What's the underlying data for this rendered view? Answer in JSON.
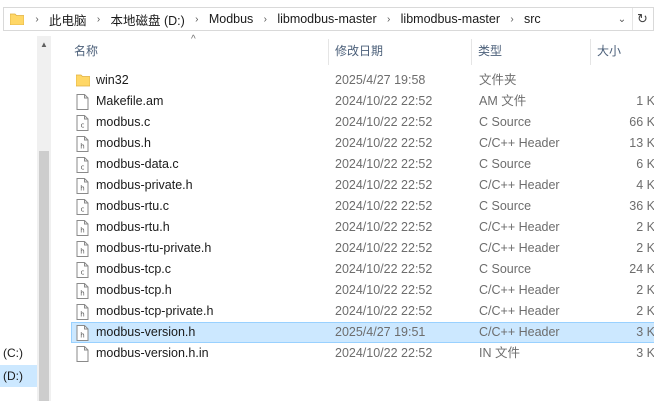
{
  "address": {
    "crumbs": [
      "此电脑",
      "本地磁盘 (D:)",
      "Modbus",
      "libmodbus-master",
      "libmodbus-master",
      "src"
    ],
    "separator": "›",
    "dropdown": "⌄",
    "refresh": "↻"
  },
  "nav": {
    "items": [
      {
        "label": "(C:)",
        "selected": false
      },
      {
        "label": "(D:)",
        "selected": true
      }
    ]
  },
  "columns": {
    "name": "名称",
    "date": "修改日期",
    "type": "类型",
    "size": "大小"
  },
  "files": [
    {
      "name": "win32",
      "date": "2025/4/27 19:58",
      "type": "文件夹",
      "size": "",
      "icon": "folder-icon",
      "selected": false
    },
    {
      "name": "Makefile.am",
      "date": "2024/10/22 22:52",
      "type": "AM 文件",
      "size": "1 K",
      "icon": "file-icon",
      "selected": false
    },
    {
      "name": "modbus.c",
      "date": "2024/10/22 22:52",
      "type": "C Source",
      "size": "66 K",
      "icon": "c-source-icon",
      "selected": false
    },
    {
      "name": "modbus.h",
      "date": "2024/10/22 22:52",
      "type": "C/C++ Header",
      "size": "13 K",
      "icon": "header-file-icon",
      "selected": false
    },
    {
      "name": "modbus-data.c",
      "date": "2024/10/22 22:52",
      "type": "C Source",
      "size": "6 K",
      "icon": "c-source-icon",
      "selected": false
    },
    {
      "name": "modbus-private.h",
      "date": "2024/10/22 22:52",
      "type": "C/C++ Header",
      "size": "4 K",
      "icon": "header-file-icon",
      "selected": false
    },
    {
      "name": "modbus-rtu.c",
      "date": "2024/10/22 22:52",
      "type": "C Source",
      "size": "36 K",
      "icon": "c-source-icon",
      "selected": false
    },
    {
      "name": "modbus-rtu.h",
      "date": "2024/10/22 22:52",
      "type": "C/C++ Header",
      "size": "2 K",
      "icon": "header-file-icon",
      "selected": false
    },
    {
      "name": "modbus-rtu-private.h",
      "date": "2024/10/22 22:52",
      "type": "C/C++ Header",
      "size": "2 K",
      "icon": "header-file-icon",
      "selected": false
    },
    {
      "name": "modbus-tcp.c",
      "date": "2024/10/22 22:52",
      "type": "C Source",
      "size": "24 K",
      "icon": "c-source-icon",
      "selected": false
    },
    {
      "name": "modbus-tcp.h",
      "date": "2024/10/22 22:52",
      "type": "C/C++ Header",
      "size": "2 K",
      "icon": "header-file-icon",
      "selected": false
    },
    {
      "name": "modbus-tcp-private.h",
      "date": "2024/10/22 22:52",
      "type": "C/C++ Header",
      "size": "2 K",
      "icon": "header-file-icon",
      "selected": false
    },
    {
      "name": "modbus-version.h",
      "date": "2025/4/27 19:51",
      "type": "C/C++ Header",
      "size": "3 K",
      "icon": "header-file-icon",
      "selected": true
    },
    {
      "name": "modbus-version.h.in",
      "date": "2024/10/22 22:52",
      "type": "IN 文件",
      "size": "3 K",
      "icon": "file-icon",
      "selected": false
    }
  ],
  "colors": {
    "selection_bg": "#cce8ff",
    "selection_border": "#99d1ff",
    "header_text": "#4c607a",
    "folder_yellow": "#ffd766"
  }
}
